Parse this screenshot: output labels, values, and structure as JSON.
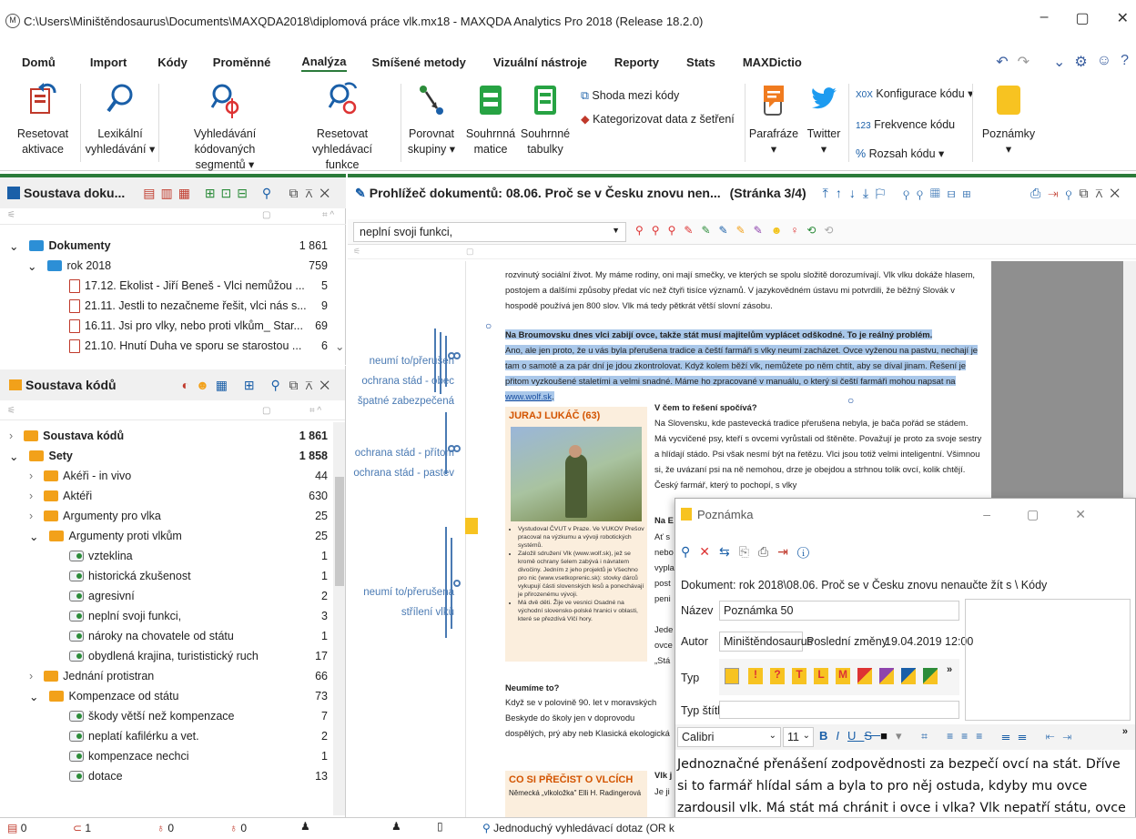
{
  "window": {
    "title": "C:\\Users\\Miništěndosaurus\\Documents\\MAXQDA2018\\diplomová práce vlk.mx18 - MAXQDA Analytics Pro 2018 (Release 18.2.0)",
    "app_icon": "M",
    "min": "–",
    "max": "▢",
    "close": "✕"
  },
  "tabs": [
    "Domů",
    "Import",
    "Kódy",
    "Proměnné",
    "Analýza",
    "Smíšené metody",
    "Vizuální nástroje",
    "Reporty",
    "Stats",
    "MAXDictio"
  ],
  "active_tab": "Analýza",
  "ribbon": {
    "reset_activations": [
      "Resetovat",
      "aktivace"
    ],
    "lexical_search": [
      "Lexikální",
      "vyhledávání ▾"
    ],
    "coded_segment_search": [
      "Vyhledávání kódovaných",
      "segmentů ▾"
    ],
    "reset_search": [
      "Resetovat vyhledávací",
      "funkce"
    ],
    "compare_groups": [
      "Porovnat",
      "skupiny ▾"
    ],
    "summary_matrix": [
      "Souhrnná",
      "matice"
    ],
    "summary_tables": [
      "Souhrnné",
      "tabulky"
    ],
    "code_agreement": "Shoda mezi kódy",
    "categorize_survey": "Kategorizovat data z šetření",
    "paraphrase": [
      "Parafráze",
      "▾"
    ],
    "twitter": [
      "Twitter",
      "▾"
    ],
    "code_config": "Konfigurace kódu ▾",
    "code_frequency": "Frekvence kódu",
    "code_range": "Rozsah kódu ▾",
    "memos": [
      "Poznámky",
      "▾"
    ],
    "code_config_prefix": "X0X",
    "code_frequency_prefix": "123",
    "code_range_prefix": "%"
  },
  "doc_system": {
    "title": "Soustava doku...",
    "rows": [
      {
        "label": "Dokumenty",
        "count": "1 861",
        "bold": true
      },
      {
        "label": "rok 2018",
        "count": "759"
      },
      {
        "label": "17.12. Ekolist - Jiří Beneš - Vlci nemůžou ...",
        "count": "5"
      },
      {
        "label": "21.11. Jestli to nezačneme řešit, vlci nás s...",
        "count": "9"
      },
      {
        "label": "16.11. Jsi pro vlky, nebo proti vlkům_ Star...",
        "count": "69"
      },
      {
        "label": "21.10. Hnutí Duha ve sporu se starostou ...",
        "count": "6"
      }
    ]
  },
  "code_system": {
    "title": "Soustava kódů",
    "rows": [
      {
        "label": "Soustava kódů",
        "count": "1 861"
      },
      {
        "label": "Sety",
        "count": "1 858"
      },
      {
        "label": "Akéři - in vivo",
        "count": "44"
      },
      {
        "label": "Aktéři",
        "count": "630"
      },
      {
        "label": "Argumenty pro vlka",
        "count": "25"
      },
      {
        "label": "Argumenty proti vlkům",
        "count": "25"
      },
      {
        "label": "vzteklina",
        "count": "1"
      },
      {
        "label": "historická zkušenost",
        "count": "1"
      },
      {
        "label": "agresivní",
        "count": "2"
      },
      {
        "label": "neplní svoji funkci,",
        "count": "3"
      },
      {
        "label": "nároky na chovatele od státu",
        "count": "1"
      },
      {
        "label": "obydlená krajina, turististický ruch",
        "count": "17"
      },
      {
        "label": "Jednání protistran",
        "count": "66"
      },
      {
        "label": "Kompenzace od státu",
        "count": "73"
      },
      {
        "label": "škody větší než kompenzace",
        "count": "7"
      },
      {
        "label": "neplatí kafilérku a vet.",
        "count": "2"
      },
      {
        "label": "kompenzace nechci",
        "count": "1"
      },
      {
        "label": "dotace",
        "count": "13"
      }
    ]
  },
  "viewer": {
    "title": "Prohlížeč dokumentů: 08.06. Proč se v Česku znovu nen...",
    "page": "(Stránka 3/4)",
    "code_dropdown": "neplní svoji funkci,",
    "margin_codes": [
      "neumí to/přerušen",
      "ochrana stád - obec",
      "špatné zabezpečená",
      "ochrana stád - přítom",
      "ochrana stád - pastev",
      "neumí to/přerušená",
      "střílení vlků"
    ],
    "para1": "rozvinutý sociální život. My máme rodiny, oni mají smečky, ve kterých se spolu složitě dorozumívají. Vlk vlku dokáže hlasem, postojem a dalšími způsoby předat víc než čtyři tisíce významů. V jazykovědném ústavu mi potvrdili, že běžný Slovák v hospodě používá jen 800 slov. Vlk má tedy pětkrát větší slovní zásobu.",
    "hl_bold": "Na Broumovsku dnes vlci zabijí ovce, takže stát musí majitelům vyplácet odškodné. To je reálný problém.",
    "hl_text": "Ano, ale jen proto, že u vás byla přerušena tradice a čeští farmáři s vlky neumí zacházet. Ovce vyženou na pastvu, nechají je tam o samotě a za pár dní je jdou zkontrolovat. Když kolem běží vlk, nemůžete po něm chtít, aby se díval jinam. Řešení je přitom vyzkoušené staletími a velmi snadné. Máme ho zpracované v manuálu, o který si čeští farmáři mohou napsat na ",
    "hl_link": "www.wolf.sk",
    "box_title": "JURAJ LUKÁČ (63)",
    "box_bullets": [
      "Vystudoval ČVUT v Praze. Ve VUKOV Prešov pracoval na výzkumu a vývoji robotických systémů.",
      "Založil sdružení Vlk (www.wolf.sk), jež se kromě ochrany šelem zabývá i návratem divočiny. Jedním z jeho projektů je Všechno pro nic (www.vsetkoprenic.sk): stovky dárců vykupují části slovenských lesů a ponechávají je přirozenému vývoji.",
      "Má dvě děti. Žije ve vesnici Osadné na východní slovensko-polské hranici v oblasti, které se přezdívá Vlčí hory."
    ],
    "q_heading": "V čem to řešení spočívá?",
    "q_text": "Na Slovensku, kde pastevecká tradice přerušena nebyla, je bača pořád se stádem. Má vycvičené psy, kteří s ovcemi vyrůstali od štěněte. Považují je proto za svoje sestry a hlídají stádo. Psi však nesmí být na řetězu. Vlci jsou totiž velmi inteligentní. Všimnou si, že uvázaní psi na ně nemohou, drze je obejdou a strhnou tolik ovcí, kolik chtějí. Český farmář, který to pochopí, s vlky",
    "frag_na": "Na E",
    "frag_lines": [
      "Ať s",
      "nebo",
      "vypla",
      "post",
      "peni",
      "",
      "Jede",
      "ovce",
      "„Stá"
    ],
    "neumime": "Neumíme to?",
    "neumime_text": "Když se v polovině 90. let v moravských Beskyde do školy jen v doprovodu dospělých, prý aby neb Klasická ekologická výchova nefunguje, na rozdíl bezproblémový život s nimi nevyzkoušejí, neuvěř",
    "co_si": "CO SI PŘEČIST O VLCÍCH",
    "co_si_text": "Německá „vlkoložka\" Elli H. Radingerová",
    "vlk_frag": "Vlk j",
    "je_frag": "Je ji"
  },
  "note": {
    "title": "Poznámka",
    "document": "Dokument: rok 2018\\08.06. Proč se v Česku znovu nenaučte žít s \\ Kódy",
    "name_label": "Název",
    "name_value": "Poznámka 50",
    "author_label": "Autor",
    "author_value": "Miništěndosaurus",
    "last_changed_label": "Poslední změny",
    "last_changed_value": "19.04.2019 12:00",
    "type_label": "Typ",
    "tag_label": "Typ štítku",
    "tag_glyphs": [
      "!",
      "?",
      "T",
      "L",
      "M"
    ],
    "tags_more": "»",
    "format_more": "»",
    "font": "Calibri",
    "size": "11",
    "text": "Jednoznačné přenášení zodpovědnosti za bezpečí ovcí na stát. Dříve si to farmář hlídal sám a byla to pro něj ostuda, kdyby mu ovce zardousil vlk. Má stát má chránit i ovce i vlka? Vlk nepatří státu, ovce patří chovateli."
  },
  "status": {
    "docs": "0",
    "codes": "1",
    "codes2": "0",
    "codes3": "0",
    "search": "Jednoduchý vyhledávací dotaz (OR k"
  },
  "colors": {
    "accent_green": "#2b7b3a",
    "highlight": "#aac8ea",
    "code_blue": "#4a7ab3",
    "folder_blue": "#2c8fd6",
    "orange": "#f2a11a"
  }
}
